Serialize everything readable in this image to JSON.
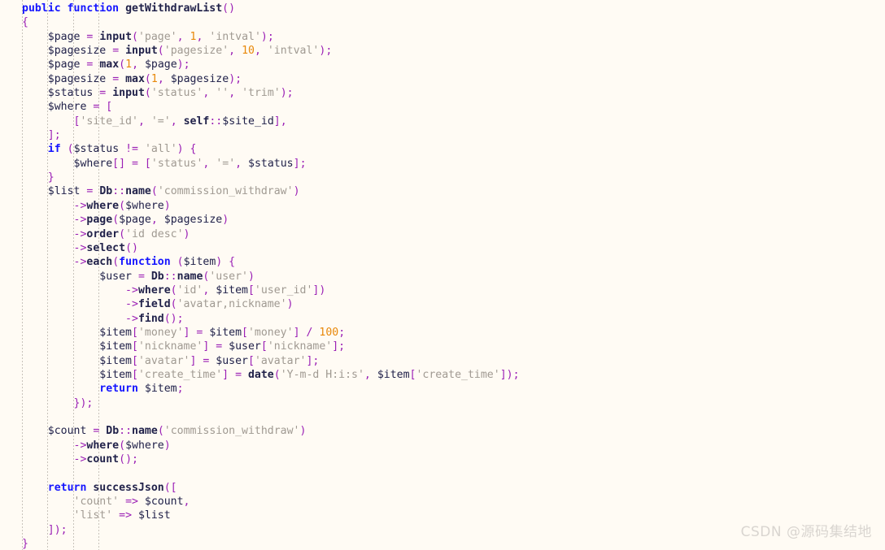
{
  "editor": {
    "language": "php",
    "background_color": "#fffbf4",
    "indent_guide_color": "#c9c3bb",
    "indent_guide_positions": [
      27,
      58,
      90,
      121
    ],
    "char_width": 7.82,
    "line_height": 17.35,
    "colors": {
      "keyword": "#1515ff",
      "function": "#21224a",
      "variable": "#21224a",
      "operator": "#9b1fb5",
      "string": "#a09a92",
      "number": "#e8880a",
      "default": "#21224a"
    }
  },
  "watermark": {
    "text": "CSDN @源码集结地"
  },
  "code": {
    "lines": [
      "public function getWithdrawList()",
      "{",
      "    $page = input('page', 1, 'intval');",
      "    $pagesize = input('pagesize', 10, 'intval');",
      "    $page = max(1, $page);",
      "    $pagesize = max(1, $pagesize);",
      "    $status = input('status', '', 'trim');",
      "    $where = [",
      "        ['site_id', '=', self::$site_id],",
      "    ];",
      "    if ($status != 'all') {",
      "        $where[] = ['status', '=', $status];",
      "    }",
      "    $list = Db::name('commission_withdraw')",
      "        ->where($where)",
      "        ->page($page, $pagesize)",
      "        ->order('id desc')",
      "        ->select()",
      "        ->each(function ($item) {",
      "            $user = Db::name('user')",
      "                ->where('id', $item['user_id'])",
      "                ->field('avatar,nickname')",
      "                ->find();",
      "            $item['money'] = $item['money'] / 100;",
      "            $item['nickname'] = $user['nickname'];",
      "            $item['avatar'] = $user['avatar'];",
      "            $item['create_time'] = date('Y-m-d H:i:s', $item['create_time']);",
      "            return $item;",
      "        });",
      "",
      "    $count = Db::name('commission_withdraw')",
      "        ->where($where)",
      "        ->count();",
      "",
      "    return successJson([",
      "        'count' => $count,",
      "        'list' => $list",
      "    ]);",
      "}"
    ],
    "line_count": 38
  }
}
